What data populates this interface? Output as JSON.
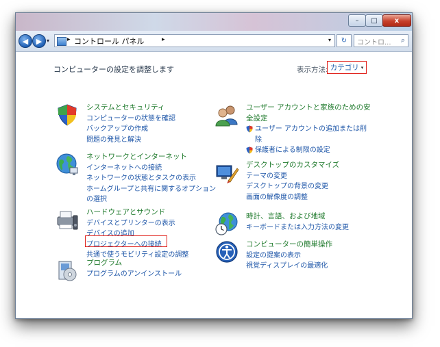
{
  "window": {
    "caption_minimize": "–",
    "caption_maximize": "□",
    "caption_close": "x"
  },
  "address_bar": {
    "back_arrow": "◀",
    "forward_arrow": "▶",
    "nav_dropdown": "▾",
    "sep1": "▸",
    "path": "コントロール パネル",
    "sep2": "▸",
    "dropdown": "▾",
    "refresh": "↻",
    "search_placeholder": "コントロ...",
    "search_icon": "⌕"
  },
  "header": {
    "title": "コンピューターの設定を調整します",
    "view_label": "表示方法:",
    "view_value": "カテゴリ",
    "view_dropdown": "▾"
  },
  "categories_left": [
    {
      "icon": "system-security-icon",
      "title": "システムとセキュリティ",
      "links": [
        "コンピューターの状態を確認",
        "バックアップの作成",
        "問題の発見と解決"
      ]
    },
    {
      "icon": "network-internet-icon",
      "title": "ネットワークとインターネット",
      "links": [
        "インターネットへの接続",
        "ネットワークの状態とタスクの表示",
        "ホームグループと共有に関するオプションの選択"
      ]
    },
    {
      "icon": "hardware-sound-icon",
      "title": "ハードウェアとサウンド",
      "links": [
        "デバイスとプリンターの表示",
        "デバイスの追加",
        "プロジェクターへの接続",
        "共通で使うモビリティ設定の調整"
      ]
    },
    {
      "icon": "programs-icon",
      "title": "プログラム",
      "links": [
        "プログラムのアンインストール"
      ]
    }
  ],
  "categories_right": [
    {
      "icon": "user-accounts-icon",
      "title": "ユーザー アカウントと家族のための安全設定",
      "links": [
        "ユーザー アカウントの追加または削除",
        "保護者による制限の設定"
      ]
    },
    {
      "icon": "appearance-icon",
      "title": "デスクトップのカスタマイズ",
      "links": [
        "テーマの変更",
        "デスクトップの背景の変更",
        "画面の解像度の調整"
      ]
    },
    {
      "icon": "clock-language-region-icon",
      "title": "時計、言語、および地域",
      "links": [
        "キーボードまたは入力方法の変更"
      ]
    },
    {
      "icon": "ease-of-access-icon",
      "title": "コンピューターの簡単操作",
      "links": [
        "設定の提案の表示",
        "視覚ディスプレイの最適化"
      ]
    }
  ],
  "colors": {
    "category_title": "#1f7a2c",
    "link": "#1e56a8",
    "highlight_box": "#e0201a"
  }
}
